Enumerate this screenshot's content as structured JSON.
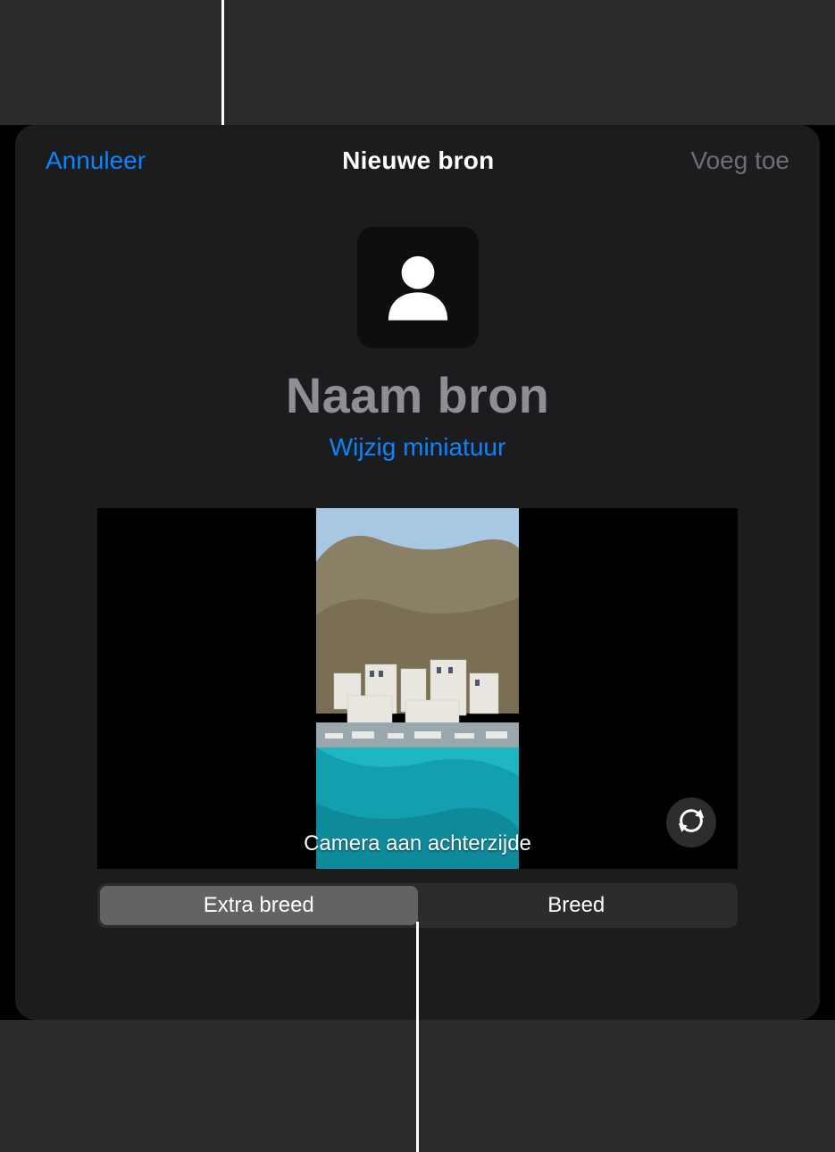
{
  "nav": {
    "cancel": "Annuleer",
    "title": "Nieuwe bron",
    "add": "Voeg toe"
  },
  "header": {
    "name_placeholder": "Naam bron",
    "edit_thumbnail": "Wijzig miniatuur"
  },
  "preview": {
    "camera_label": "Camera aan achterzijde"
  },
  "segments": {
    "extra_wide": "Extra breed",
    "wide": "Breed"
  },
  "icons": {
    "avatar": "person-icon",
    "flip": "camera-flip-icon"
  },
  "colors": {
    "accent": "#0a84ff",
    "disabled": "#6e6e73",
    "sheet_bg": "#1c1c1e"
  }
}
